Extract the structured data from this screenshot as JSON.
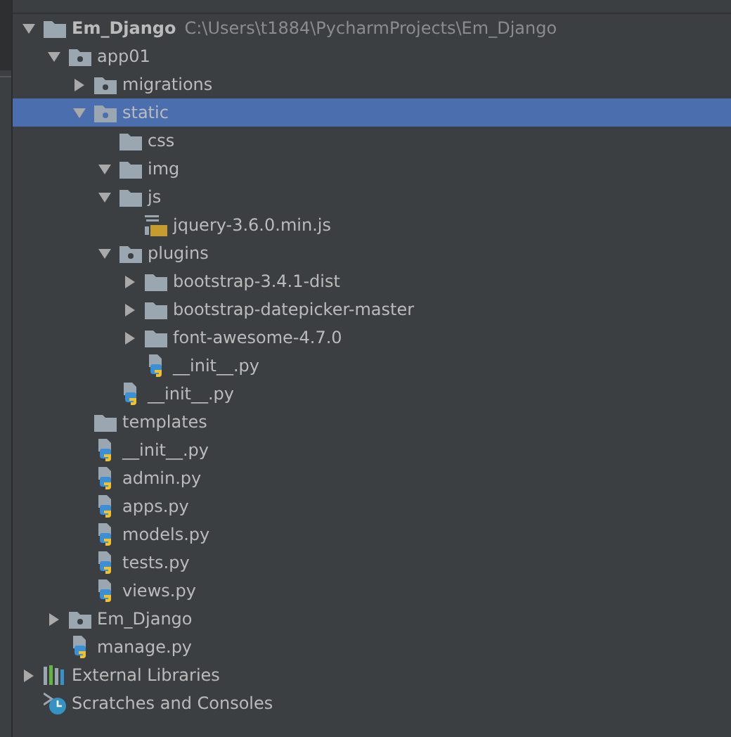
{
  "tree": [
    {
      "name": "Em_Django",
      "path": "C:\\Users\\t1884\\PycharmProjects\\Em_Django",
      "kind": "folder",
      "expanded": true,
      "selected": false,
      "children": [
        {
          "name": "app01",
          "kind": "package",
          "expanded": true,
          "selected": false,
          "children": [
            {
              "name": "migrations",
              "kind": "package",
              "expanded": false,
              "selected": false
            },
            {
              "name": "static",
              "kind": "resource",
              "expanded": true,
              "selected": true,
              "children": [
                {
                  "name": "css",
                  "kind": "folder",
                  "selected": false
                },
                {
                  "name": "img",
                  "kind": "folder",
                  "expanded": true,
                  "selected": false
                },
                {
                  "name": "js",
                  "kind": "folder",
                  "expanded": true,
                  "selected": false,
                  "children": [
                    {
                      "name": "jquery-3.6.0.min.js",
                      "kind": "js",
                      "selected": false
                    }
                  ]
                },
                {
                  "name": "plugins",
                  "kind": "package",
                  "expanded": true,
                  "selected": false,
                  "children": [
                    {
                      "name": "bootstrap-3.4.1-dist",
                      "kind": "folder",
                      "expanded": false,
                      "selected": false
                    },
                    {
                      "name": "bootstrap-datepicker-master",
                      "kind": "folder",
                      "expanded": false,
                      "selected": false
                    },
                    {
                      "name": "font-awesome-4.7.0",
                      "kind": "folder",
                      "expanded": false,
                      "selected": false
                    },
                    {
                      "name": "__init__.py",
                      "kind": "python",
                      "selected": false
                    }
                  ]
                },
                {
                  "name": "__init__.py",
                  "kind": "python",
                  "selected": false
                }
              ]
            },
            {
              "name": "templates",
              "kind": "folder",
              "selected": false
            },
            {
              "name": "__init__.py",
              "kind": "python",
              "selected": false
            },
            {
              "name": "admin.py",
              "kind": "python",
              "selected": false
            },
            {
              "name": "apps.py",
              "kind": "python",
              "selected": false
            },
            {
              "name": "models.py",
              "kind": "python",
              "selected": false
            },
            {
              "name": "tests.py",
              "kind": "python",
              "selected": false
            },
            {
              "name": "views.py",
              "kind": "python",
              "selected": false
            }
          ]
        },
        {
          "name": "Em_Django",
          "kind": "package",
          "expanded": false,
          "selected": false
        },
        {
          "name": "manage.py",
          "kind": "python",
          "selected": false
        }
      ]
    },
    {
      "name": "External Libraries",
      "kind": "libraries",
      "expanded": false,
      "selected": false
    },
    {
      "name": "Scratches and Consoles",
      "kind": "scratches",
      "selected": false
    }
  ]
}
